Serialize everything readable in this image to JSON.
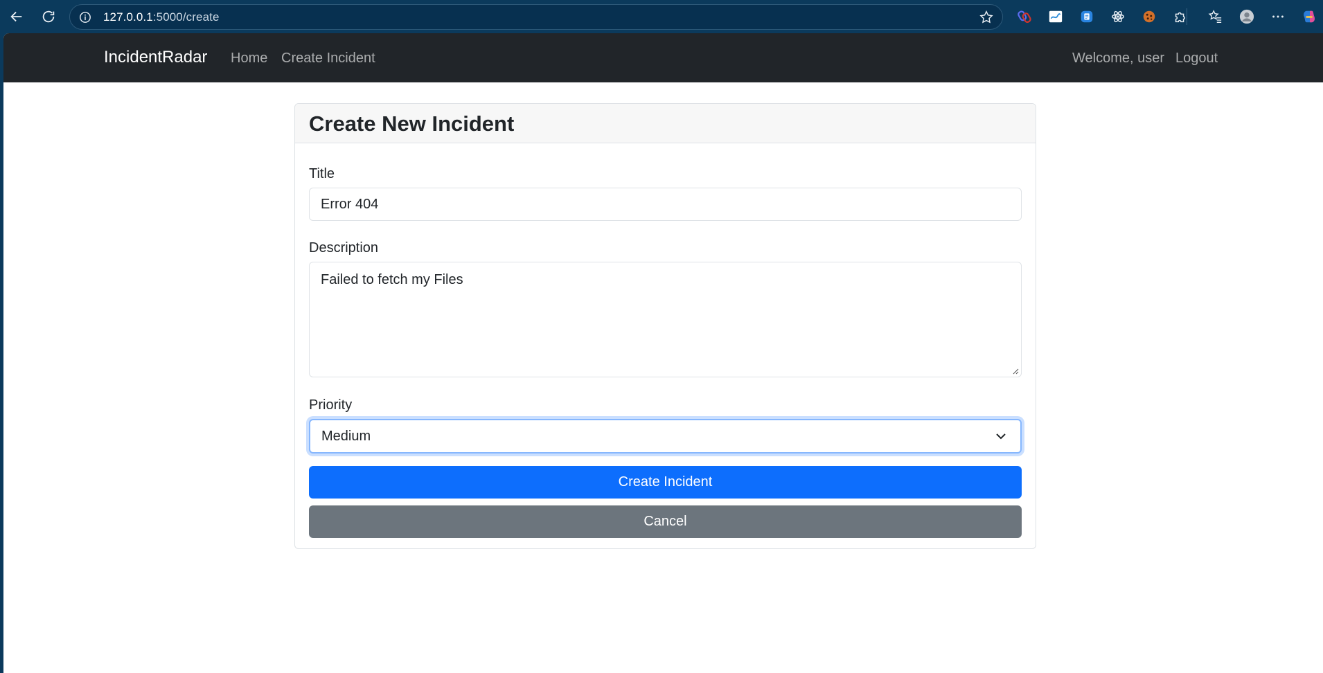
{
  "browser": {
    "url_host": "127.0.0.1",
    "url_path": ":5000/create",
    "extensions": [
      "link-icon",
      "swirl-icon",
      "doc-icon",
      "atom-icon",
      "cookie-icon",
      "puzzle-icon"
    ]
  },
  "navbar": {
    "brand": "IncidentRadar",
    "links": [
      "Home",
      "Create Incident"
    ],
    "welcome": "Welcome, user",
    "logout": "Logout"
  },
  "form": {
    "title": "Create New Incident",
    "title_label": "Title",
    "title_value": "Error 404",
    "description_label": "Description",
    "description_value": "Failed to fetch my Files",
    "priority_label": "Priority",
    "priority_value": "Medium",
    "submit_label": "Create Incident",
    "cancel_label": "Cancel"
  },
  "colors": {
    "navbar_bg": "#212529",
    "primary": "#0d6efd",
    "secondary": "#6c757d",
    "chrome_bg": "#0b3a5c"
  }
}
